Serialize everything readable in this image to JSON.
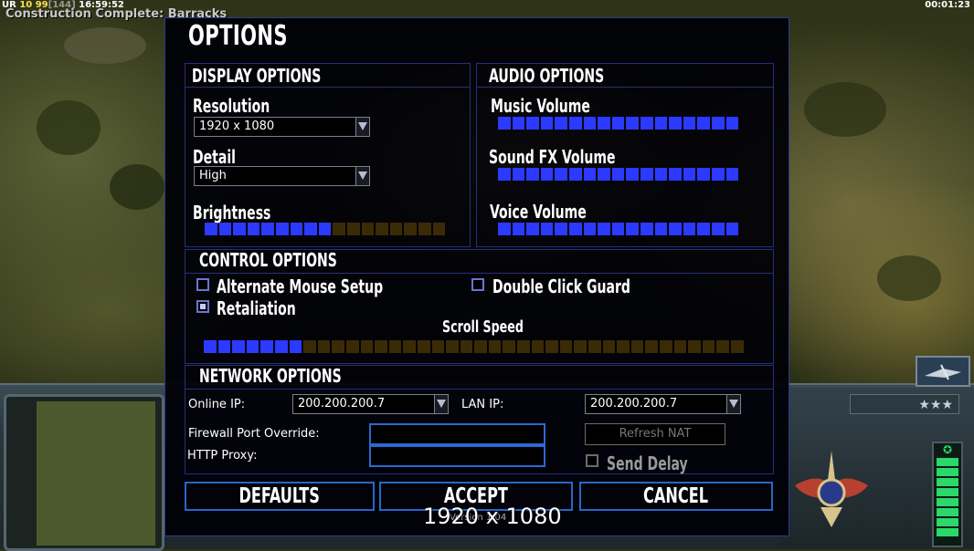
{
  "hud": {
    "stats_prefix": "UR",
    "stats_a": "10",
    "stats_b": "99",
    "stats_c": "[144]",
    "stats_clock": "16:59:52",
    "message": "Construction Complete: Barracks",
    "game_timer": "00:01:23"
  },
  "dialog": {
    "title": "OPTIONS",
    "display": {
      "heading": "DISPLAY OPTIONS",
      "resolution_label": "Resolution",
      "resolution_value": "1920 x 1080",
      "detail_label": "Detail",
      "detail_value": "High",
      "brightness_label": "Brightness",
      "brightness_level": {
        "filled": 9,
        "total": 17
      }
    },
    "audio": {
      "heading": "AUDIO OPTIONS",
      "music_label": "Music Volume",
      "music_level": {
        "filled": 17,
        "total": 17
      },
      "sfx_label": "Sound FX Volume",
      "sfx_level": {
        "filled": 17,
        "total": 17
      },
      "voice_label": "Voice Volume",
      "voice_level": {
        "filled": 17,
        "total": 17
      }
    },
    "control": {
      "heading": "CONTROL OPTIONS",
      "alt_mouse_label": "Alternate Mouse Setup",
      "alt_mouse_checked": false,
      "double_click_label": "Double Click Guard",
      "double_click_checked": false,
      "retaliation_label": "Retaliation",
      "retaliation_checked": true,
      "scroll_speed_label": "Scroll Speed",
      "scroll_speed_level": {
        "filled": 7,
        "total": 38
      }
    },
    "network": {
      "heading": "NETWORK OPTIONS",
      "online_ip_label": "Online IP:",
      "online_ip_value": "200.200.200.7",
      "lan_ip_label": "LAN IP:",
      "lan_ip_value": "200.200.200.7",
      "firewall_label": "Firewall Port Override:",
      "firewall_value": "",
      "proxy_label": "HTTP Proxy:",
      "proxy_value": "",
      "refresh_nat_label": "Refresh NAT",
      "send_delay_label": "Send Delay",
      "send_delay_checked": false
    },
    "buttons": {
      "defaults": "DEFAULTS",
      "accept": "ACCEPT",
      "cancel": "CANCEL"
    },
    "version": "Version 1.04",
    "overlay_text": "1920 x 1080"
  },
  "colors": {
    "slider_on": "#2c39ff",
    "slider_off": "#3b2a06",
    "border_blue": "#2867c8"
  },
  "icons": [
    "dropdown-arrow-icon",
    "checkbox-icon",
    "star-icon",
    "faction-emblem-icon",
    "unit-portrait-icon"
  ]
}
